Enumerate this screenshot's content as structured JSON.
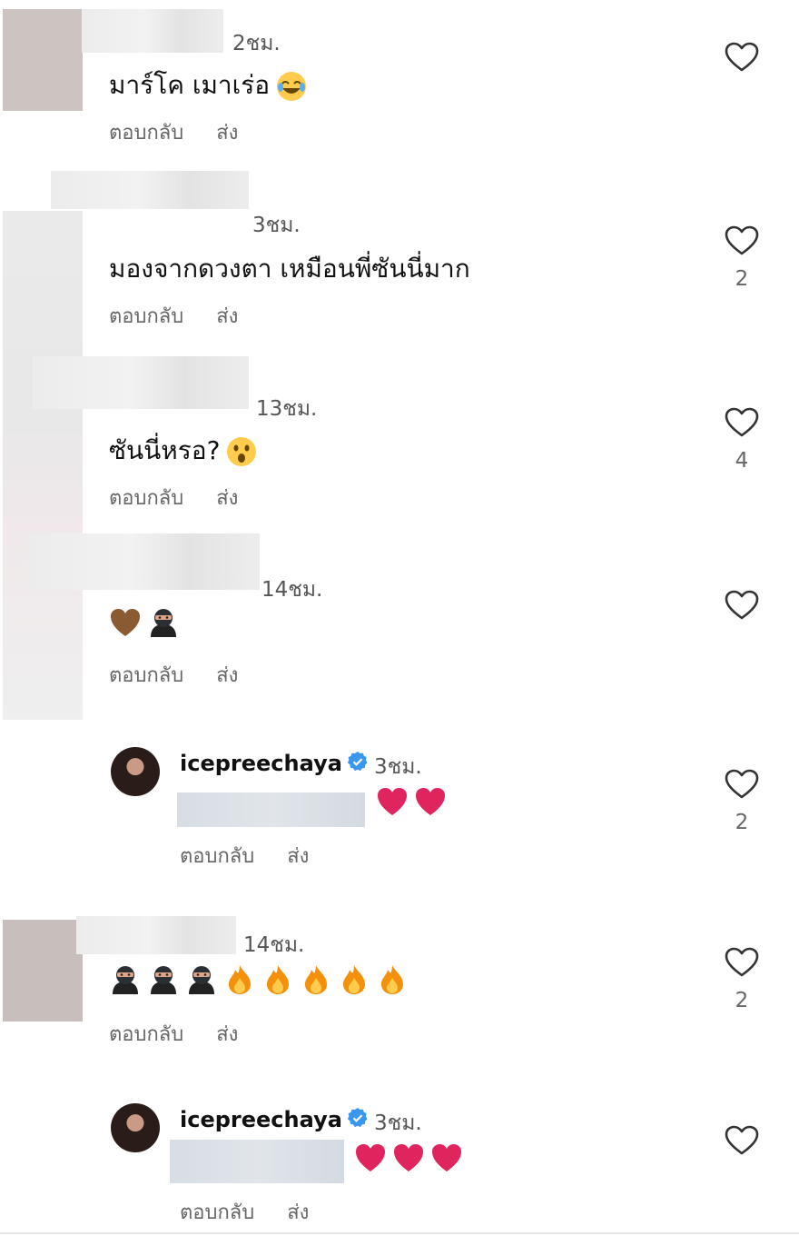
{
  "actions": {
    "reply": "ตอบกลับ",
    "send": "ส่ง"
  },
  "comments": [
    {
      "time": "2ชม.",
      "text": "มาร์โค เมาเร่อ",
      "likes": ""
    },
    {
      "time": "3ชม.",
      "text": "มองจากดวงตา เหมือนพี่ซันนี่มาก",
      "likes": "2"
    },
    {
      "time": "13ชม.",
      "text": "ซันนี่หรอ?",
      "likes": "4"
    },
    {
      "time": "14ชม.",
      "text": "",
      "likes": ""
    },
    {
      "username": "icepreechaya",
      "time": "3ชม.",
      "likes": "2"
    },
    {
      "time": "14ชม.",
      "likes": "2"
    },
    {
      "username": "icepreechaya",
      "time": "3ชม.",
      "likes": ""
    }
  ],
  "icons": [
    "heart-outline-icon",
    "verified-badge-icon",
    "laughing-emoji-icon",
    "surprised-emoji-icon",
    "brown-heart-emoji-icon",
    "ninja-emoji-icon",
    "red-heart-emoji-icon",
    "fire-emoji-icon"
  ],
  "colors": {
    "verified": "#3897f0",
    "secondary_text": "#666666",
    "red_heart": "#e0245e"
  }
}
